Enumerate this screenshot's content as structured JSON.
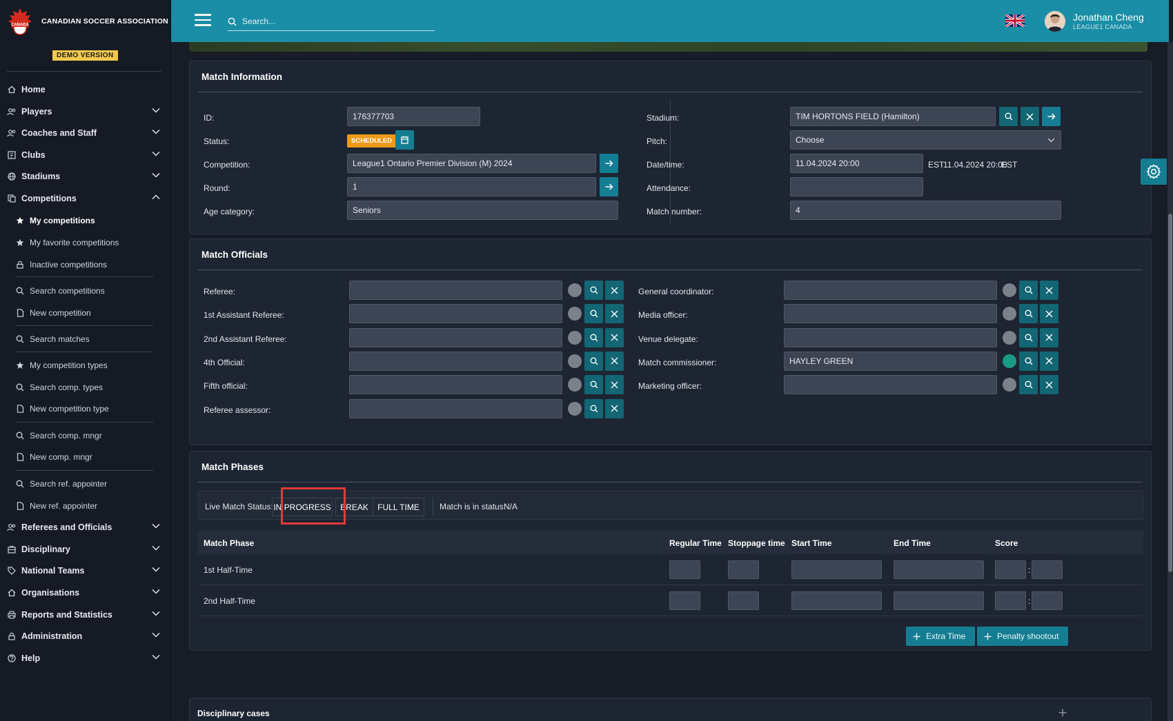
{
  "app": {
    "org_name": "CANADIAN SOCCER ASSOCIATION",
    "demo_label": "DEMO VERSION"
  },
  "header": {
    "search_placeholder": "Search...",
    "user_name": "Jonathan Cheng",
    "user_org": "LEAGUE1 CANADA"
  },
  "sidebar": {
    "home": "Home",
    "players": "Players",
    "coaches": "Coaches and Staff",
    "clubs": "Clubs",
    "stadiums": "Stadiums",
    "competitions": "Competitions",
    "my_competitions": "My competitions",
    "fav_competitions": "My favorite competitions",
    "inactive_competitions": "Inactive competitions",
    "search_competitions": "Search competitions",
    "new_competition": "New competition",
    "search_matches": "Search matches",
    "my_comp_types": "My competition types",
    "search_comp_types": "Search comp. types",
    "new_comp_type": "New competition type",
    "search_comp_mngr": "Search comp. mngr",
    "new_comp_mngr": "New comp. mngr",
    "search_ref_appointer": "Search ref. appointer",
    "new_ref_appointer": "New ref. appointer",
    "referees": "Referees and Officials",
    "disciplinary": "Disciplinary",
    "national_teams": "National Teams",
    "organisations": "Organisations",
    "reports": "Reports and Statistics",
    "administration": "Administration",
    "help": "Help"
  },
  "match_info": {
    "title": "Match Information",
    "id_label": "ID:",
    "id_value": "176377703",
    "status_label": "Status:",
    "status_value": "SCHEDULED",
    "competition_label": "Competition:",
    "competition_value": "League1 Ontario Premier Division (M) 2024",
    "round_label": "Round:",
    "round_value": "1",
    "age_label": "Age category:",
    "age_value": "Seniors",
    "stadium_label": "Stadium:",
    "stadium_value": "TIM HORTONS FIELD (Hamilton)",
    "pitch_label": "Pitch:",
    "pitch_value": "Choose",
    "datetime_label": "Date/time:",
    "datetime_value": "11.04.2024 20:00",
    "datetime_tz": "EST",
    "datetime_local": "11.04.2024 20:00",
    "datetime_local_tz": "EST",
    "attendance_label": "Attendance:",
    "attendance_value": "",
    "match_number_label": "Match number:",
    "match_number_value": "4"
  },
  "officials": {
    "title": "Match Officials",
    "left": [
      {
        "label": "Referee:",
        "value": ""
      },
      {
        "label": "1st Assistant Referee:",
        "value": ""
      },
      {
        "label": "2nd Assistant Referee:",
        "value": ""
      },
      {
        "label": "4th Official:",
        "value": ""
      },
      {
        "label": "Fifth official:",
        "value": ""
      },
      {
        "label": "Referee assessor:",
        "value": ""
      }
    ],
    "right": [
      {
        "label": "General coordinator:",
        "value": ""
      },
      {
        "label": "Media officer:",
        "value": ""
      },
      {
        "label": "Venue delegate:",
        "value": ""
      },
      {
        "label": "Match commissioner:",
        "value": "HAYLEY GREEN"
      },
      {
        "label": "Marketing officer:",
        "value": ""
      }
    ]
  },
  "phases": {
    "title": "Match Phases",
    "live_label": "Live Match Status:",
    "btn_in_progress": "IN PROGRESS",
    "btn_break": "BREAK",
    "btn_full_time": "FULL TIME",
    "status_text": "Match is in status:",
    "status_value": "N/A",
    "columns": [
      "Match Phase",
      "Regular Time",
      "Stoppage time",
      "Start Time",
      "End Time",
      "Score"
    ],
    "rows": [
      {
        "name": "1st Half-Time"
      },
      {
        "name": "2nd Half-Time"
      }
    ],
    "score_sep": ":",
    "extra_time": "Extra Time",
    "penalty": "Penalty shootout"
  },
  "disciplinary": {
    "title": "Disciplinary cases"
  },
  "colors": {
    "accent": "#157d92",
    "header": "#1a8ea6",
    "badge": "#f09819",
    "highlight": "#e03a3a"
  }
}
